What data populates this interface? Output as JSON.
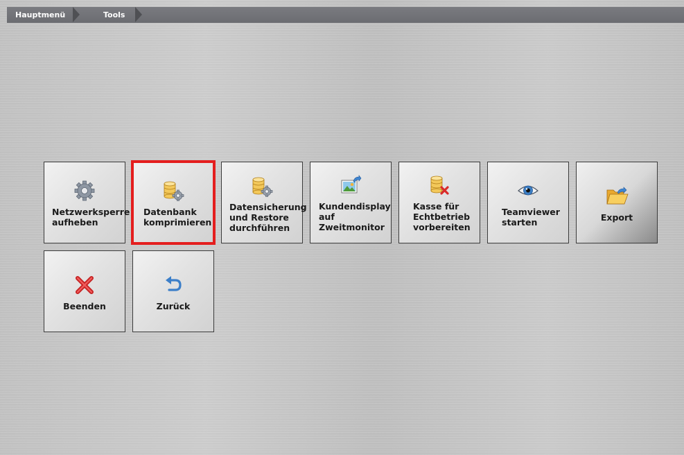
{
  "breadcrumb": {
    "items": [
      "Hauptmenü",
      "Tools"
    ]
  },
  "tiles": [
    {
      "label": "Netzwerksperre\naufheben",
      "icon": "gear-icon"
    },
    {
      "label": "Datenbank\nkomprimieren",
      "icon": "database-gear-icon",
      "selected": true
    },
    {
      "label": "Datensicherung\nund Restore\ndurchführen",
      "icon": "database-gear-icon"
    },
    {
      "label": "Kundendisplay\nauf\nZweitmonitor",
      "icon": "picture-arrow-icon"
    },
    {
      "label": "Kasse für\nEchtbetrieb\nvorbereiten",
      "icon": "database-delete-icon"
    },
    {
      "label": "Teamviewer\nstarten",
      "icon": "eye-icon"
    },
    {
      "label": "Export",
      "icon": "folder-arrow-icon"
    },
    {
      "label": "Beenden",
      "icon": "close-icon"
    },
    {
      "label": "Zurück",
      "icon": "back-arrow-icon"
    }
  ],
  "colors": {
    "selection_border": "#e41e1e",
    "breadcrumb_bar": "#737479"
  }
}
